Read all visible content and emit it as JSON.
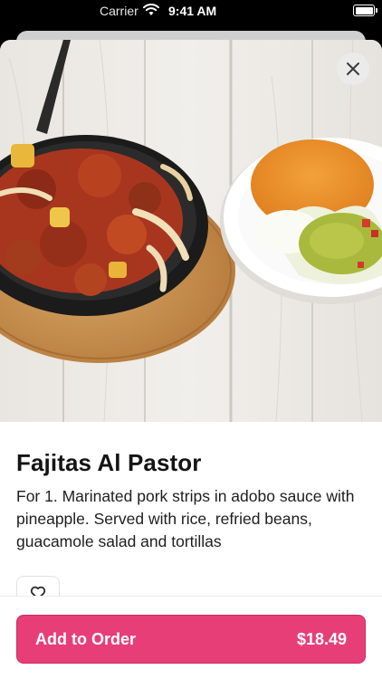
{
  "status_bar": {
    "carrier": "Carrier",
    "time": "9:41 AM"
  },
  "item": {
    "name": "Fajitas Al Pastor",
    "description": "For 1. Marinated pork strips in adobo sauce with pineapple. Served with rice, refried beans, guacamole salad and tortillas"
  },
  "actions": {
    "add_label": "Add to Order",
    "price": "$18.49"
  },
  "colors": {
    "accent": "#e83e78"
  },
  "icons": {
    "close": "close-icon",
    "favorite": "heart-icon",
    "wifi": "wifi-icon",
    "battery": "battery-icon"
  }
}
